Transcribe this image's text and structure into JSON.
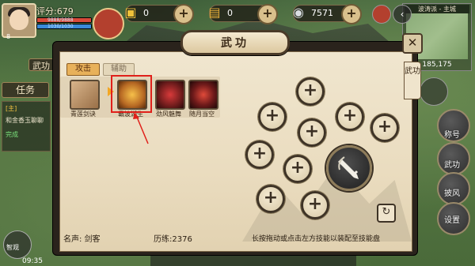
{
  "hud": {
    "score_label": "评分:679",
    "level": "8",
    "hp_text": "9888/9888",
    "mp_text": "1030/1030",
    "hp_fill": 1.0,
    "mp_fill": 1.0,
    "currencies": [
      {
        "icon": "gold-ingot-icon",
        "glyph": "▣",
        "value": "0",
        "color": "#f0c23a"
      },
      {
        "icon": "gold-bars-icon",
        "glyph": "▤",
        "value": "0",
        "color": "#e8b03a"
      },
      {
        "icon": "silver-ingot-icon",
        "glyph": "◉",
        "value": "7571",
        "color": "#d9dde2"
      }
    ],
    "plus_glyph": "+"
  },
  "map": {
    "title": "波涛派 - 主城",
    "coords": "185,175"
  },
  "left": {
    "martial_tab": "武功",
    "quest_tab": "任务",
    "quest_lines": [
      "[主]",
      "和金香玉聊聊",
      "完成"
    ],
    "side_label": "智观",
    "time": "09:35"
  },
  "right_buttons": [
    {
      "label": "称号"
    },
    {
      "label": "武功"
    },
    {
      "label": "披风"
    },
    {
      "label": "设置"
    }
  ],
  "dialog": {
    "title": "武功",
    "close_glyph": "✕",
    "side_tab": "武功",
    "tabs": {
      "active": "攻击",
      "inactive": "辅助"
    },
    "skills": [
      {
        "name": "青莲剑诀",
        "icon": "sword-scroll-icon",
        "bg": "#c9a27a"
      },
      {
        "name": "霸波湖生",
        "icon": "golden-wave-icon",
        "bg": "#b86a24"
      },
      {
        "name": "劲风魅舞",
        "icon": "red-flower-icon",
        "bg": "#7a1f1f"
      },
      {
        "name": "随月当空",
        "icon": "red-moon-icon",
        "bg": "#6e1a1a"
      }
    ],
    "slot_glyph": "+",
    "refresh_glyph": "↻",
    "footer": {
      "name_label": "名声: 剑客",
      "exp_label": "历练:2376",
      "hint": "长按拖动或点击左方技能以装配至技能盘"
    }
  }
}
